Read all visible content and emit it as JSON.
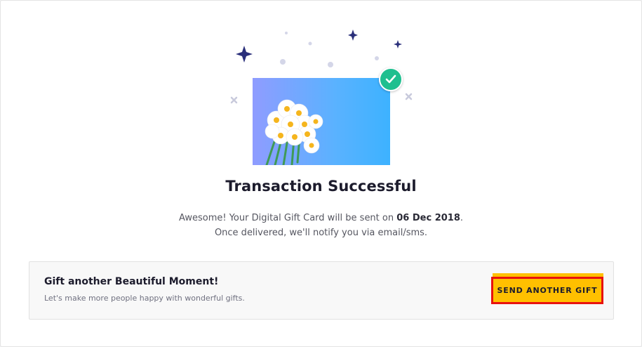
{
  "status": {
    "title": "Transaction Successful",
    "message_prefix": "Awesome! Your Digital Gift Card will be sent on ",
    "delivery_date": "06 Dec 2018",
    "message_suffix": ". Once delivered, we'll notify you via email/sms."
  },
  "promo": {
    "title": "Gift another Beautiful Moment!",
    "subtitle": "Let's make more people happy with wonderful gifts.",
    "button_label": "SEND ANOTHER GIFT"
  },
  "icons": {
    "success": "checkmark-icon",
    "decorations": [
      "sparkle-icon",
      "dot-icon",
      "cross-icon"
    ],
    "card_art": "flower-bouquet-icon"
  },
  "colors": {
    "accent_button": "#ffc000",
    "button_outline": "#e8120e",
    "success_badge": "#1fbf8f",
    "sparkle": "#2a2f7a",
    "card_gradient_start": "#8f9cff",
    "card_gradient_end": "#3db2ff"
  }
}
